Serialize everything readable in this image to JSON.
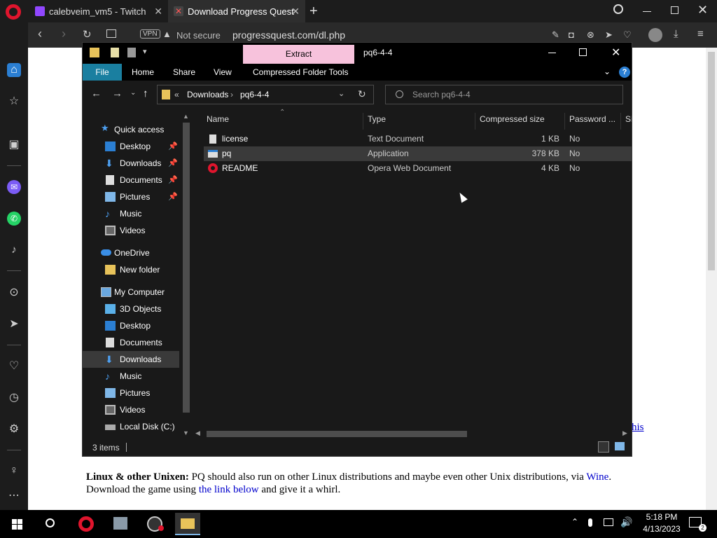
{
  "browser": {
    "tabs": [
      {
        "title": "calebveim_vm5 - Twitch",
        "active": false
      },
      {
        "title": "Download Progress Quest",
        "active": true
      }
    ],
    "vpn_label": "VPN",
    "security_label": "Not secure",
    "url": "progressquest.com/dl.php"
  },
  "page": {
    "link_fragment": "his",
    "linux_heading": "Linux & other Unixen:",
    "linux_text_1": "PQ should also run on other Linux distributions and maybe even other Unix distributions, via",
    "wine_link": "Wine",
    "linux_text_2": "Download the game using",
    "link_below": "the link below",
    "linux_text_3": "and give it a whirl."
  },
  "explorer": {
    "title": "pq6-4-4",
    "extract_label": "Extract",
    "ribbon_tabs": [
      "File",
      "Home",
      "Share",
      "View",
      "Compressed Folder Tools"
    ],
    "breadcrumb": {
      "chevrons": "«",
      "parts": [
        "Downloads",
        "pq6-4-4"
      ]
    },
    "search_placeholder": "Search pq6-4-4",
    "nav": {
      "quick_access": "Quick access",
      "quick_items": [
        "Desktop",
        "Downloads",
        "Documents",
        "Pictures",
        "Music",
        "Videos"
      ],
      "onedrive": "OneDrive",
      "new_folder": "New folder",
      "my_computer": "My Computer",
      "pc_items": [
        "3D Objects",
        "Desktop",
        "Documents",
        "Downloads",
        "Music",
        "Pictures",
        "Videos",
        "Local Disk (C:)"
      ]
    },
    "columns": [
      "Name",
      "Type",
      "Compressed size",
      "Password ...",
      "Si"
    ],
    "files": [
      {
        "name": "license",
        "type": "Text Document",
        "size": "1 KB",
        "password": "No",
        "icon": "text-file-icon"
      },
      {
        "name": "pq",
        "type": "Application",
        "size": "378 KB",
        "password": "No",
        "icon": "application-icon"
      },
      {
        "name": "README",
        "type": "Opera Web Document",
        "size": "4 KB",
        "password": "No",
        "icon": "opera-document-icon"
      }
    ],
    "status": "3 items"
  },
  "taskbar": {
    "time": "5:18 PM",
    "date": "4/13/2023"
  },
  "colors": {
    "extract_tab": "#f7c2dc",
    "file_tab": "#1a7fa0",
    "folder_yellow": "#e8c35a",
    "accent_blue": "#2b7fd3"
  }
}
